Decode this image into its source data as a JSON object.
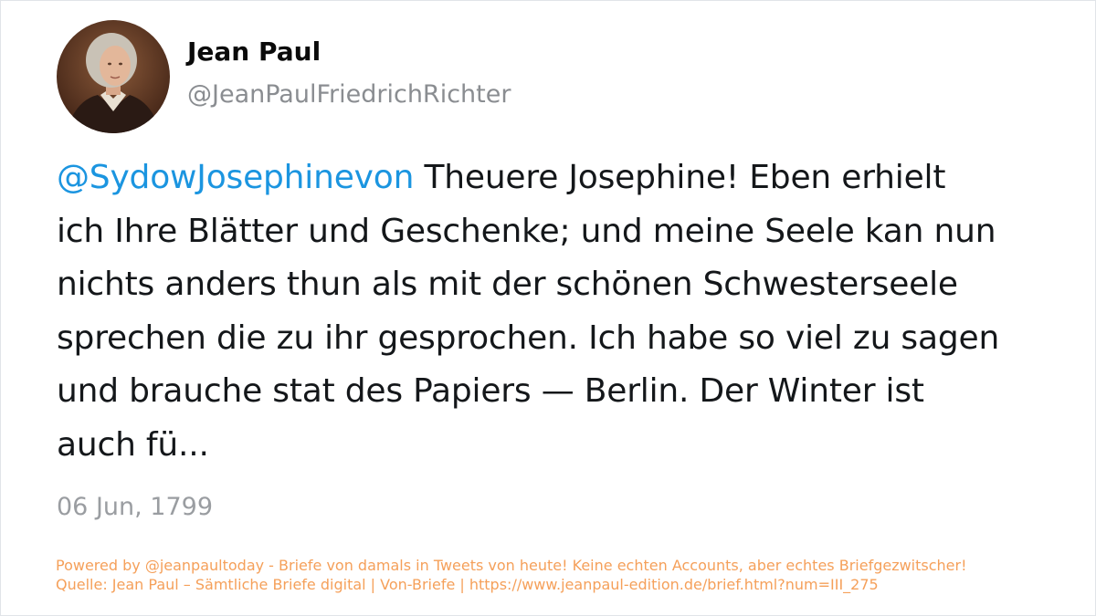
{
  "author": {
    "name": "Jean Paul",
    "handle": "@JeanPaulFriedrichRichter",
    "avatar_icon": "portrait-avatar"
  },
  "tweet": {
    "mention": "@SydowJosephinevon",
    "text_lines": [
      " Theuere Josephine! Eben erhielt",
      "ich Ihre Blätter und Geschenke; und meine Seele kan nun",
      "nichts anders thun als mit der schönen Schwesterseele",
      "sprechen die zu ihr gesprochen. Ich habe so viel zu sagen",
      "und brauche stat des Papiers — Berlin. Der Winter ist",
      "auch fü..."
    ],
    "date": "06 Jun, 1799"
  },
  "footer": {
    "line1": "Powered by @jeanpaultoday - Briefe von damals in Tweets von heute! Keine echten Accounts, aber echtes Briefgezwitscher!",
    "line2": "Quelle: Jean Paul – Sämtliche Briefe digital | Von-Briefe | https://www.jeanpaul-edition.de/brief.html?num=III_275"
  },
  "colors": {
    "mention": "#1b95e0",
    "footer": "#f5a05a",
    "handle": "#8a8d91"
  }
}
